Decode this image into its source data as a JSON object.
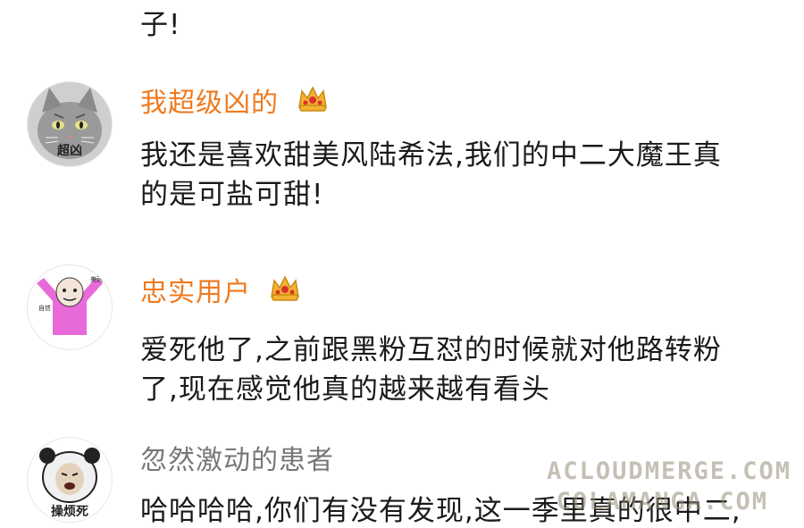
{
  "partial_top": {
    "text": "子!"
  },
  "comments": [
    {
      "username": "我超级凶的",
      "vip": true,
      "avatar_caption": "超凶",
      "lines": [
        "我还是喜欢甜美风陆希法,我们的中二大魔王真",
        "的是可盐可甜!"
      ]
    },
    {
      "username": "忠实用户",
      "vip": true,
      "avatar_caption": "",
      "lines": [
        "爱死他了,之前跟黑粉互怼的时候就对他路转粉",
        "了,现在感觉他真的越来越有看头"
      ]
    },
    {
      "username": "忽然激动的患者",
      "vip": false,
      "avatar_caption": "操烦死",
      "lines": [
        "哈哈哈哈,你们有没有发现,这一季里真的很中二,"
      ]
    }
  ],
  "watermark": {
    "line1": "ACLOUDMERGE.COM",
    "line2": "COLAMANGA.COM"
  },
  "colors": {
    "vip_name": "#f07a1e",
    "normal_name": "#777777",
    "crown_gold": "#f4b233",
    "crown_red": "#d9342b"
  },
  "icons": {
    "vip_badge": "crown-icon"
  }
}
